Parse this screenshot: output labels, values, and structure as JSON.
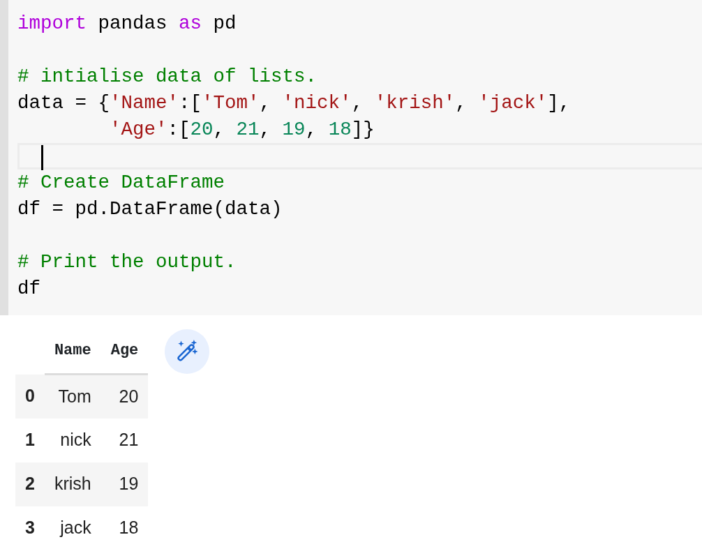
{
  "code_cell": {
    "lines": [
      {
        "kind": "code",
        "tokens": [
          {
            "kind": "keyword",
            "text": "import"
          },
          {
            "kind": "plain",
            "text": " pandas "
          },
          {
            "kind": "keyword",
            "text": "as"
          },
          {
            "kind": "plain",
            "text": " pd"
          }
        ]
      },
      {
        "kind": "blank"
      },
      {
        "kind": "code",
        "tokens": [
          {
            "kind": "comment",
            "text": "# intialise data of lists."
          }
        ]
      },
      {
        "kind": "code",
        "tokens": [
          {
            "kind": "plain",
            "text": "data = {"
          },
          {
            "kind": "string",
            "text": "'Name'"
          },
          {
            "kind": "plain",
            "text": ":["
          },
          {
            "kind": "string",
            "text": "'Tom'"
          },
          {
            "kind": "plain",
            "text": ", "
          },
          {
            "kind": "string",
            "text": "'nick'"
          },
          {
            "kind": "plain",
            "text": ", "
          },
          {
            "kind": "string",
            "text": "'krish'"
          },
          {
            "kind": "plain",
            "text": ", "
          },
          {
            "kind": "string",
            "text": "'jack'"
          },
          {
            "kind": "plain",
            "text": "],"
          }
        ]
      },
      {
        "kind": "continuation",
        "tokens": [
          {
            "kind": "string",
            "text": "'Age'"
          },
          {
            "kind": "plain",
            "text": ":["
          },
          {
            "kind": "number",
            "text": "20"
          },
          {
            "kind": "plain",
            "text": ", "
          },
          {
            "kind": "number",
            "text": "21"
          },
          {
            "kind": "plain",
            "text": ", "
          },
          {
            "kind": "number",
            "text": "19"
          },
          {
            "kind": "plain",
            "text": ", "
          },
          {
            "kind": "number",
            "text": "18"
          },
          {
            "kind": "plain",
            "text": "]}"
          }
        ]
      },
      {
        "kind": "cursor"
      },
      {
        "kind": "code",
        "tokens": [
          {
            "kind": "comment",
            "text": "# Create DataFrame"
          }
        ]
      },
      {
        "kind": "code",
        "tokens": [
          {
            "kind": "plain",
            "text": "df = pd.DataFrame(data)"
          }
        ]
      },
      {
        "kind": "blank"
      },
      {
        "kind": "code",
        "tokens": [
          {
            "kind": "comment",
            "text": "# Print the output."
          }
        ]
      },
      {
        "kind": "code",
        "tokens": [
          {
            "kind": "plain",
            "text": "df"
          }
        ]
      }
    ]
  },
  "output": {
    "table": {
      "columns": [
        "Name",
        "Age"
      ],
      "rows": [
        {
          "index": "0",
          "cells": [
            "Tom",
            "20"
          ]
        },
        {
          "index": "1",
          "cells": [
            "nick",
            "21"
          ]
        },
        {
          "index": "2",
          "cells": [
            "krish",
            "19"
          ]
        },
        {
          "index": "3",
          "cells": [
            "jack",
            "18"
          ]
        }
      ]
    }
  }
}
